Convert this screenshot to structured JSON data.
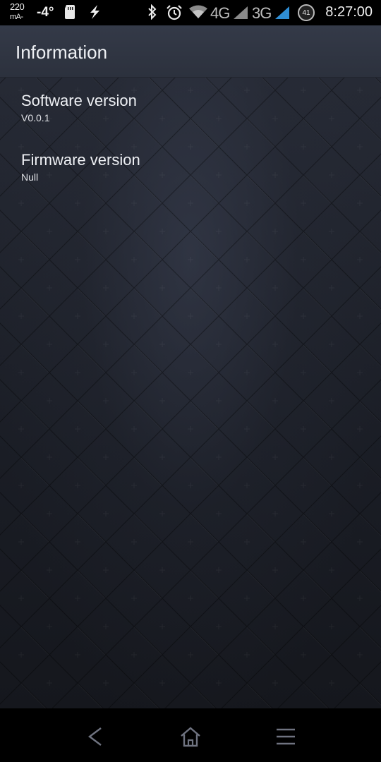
{
  "status_bar": {
    "current_value": "220",
    "current_unit": "mA-",
    "temperature": "-4°",
    "network_4g": "4G",
    "network_3g": "3G",
    "battery_level": "41",
    "time": "8:27:00",
    "icons": [
      "sd-card-icon",
      "flash-icon",
      "bluetooth-icon",
      "alarm-icon",
      "wifi-icon",
      "signal-4g-icon",
      "signal-3g-icon",
      "battery-icon"
    ]
  },
  "app_bar": {
    "title": "Information"
  },
  "preferences": [
    {
      "title": "Software version",
      "summary": "V0.0.1"
    },
    {
      "title": "Firmware version",
      "summary": "Null"
    }
  ],
  "nav_bar": {
    "buttons": [
      "back-icon",
      "home-icon",
      "menu-icon"
    ]
  },
  "colors": {
    "app_bar": "#30353f",
    "background": "#1e2129",
    "text": "#eef0f4",
    "signal_3g": "#2f8fd6"
  }
}
